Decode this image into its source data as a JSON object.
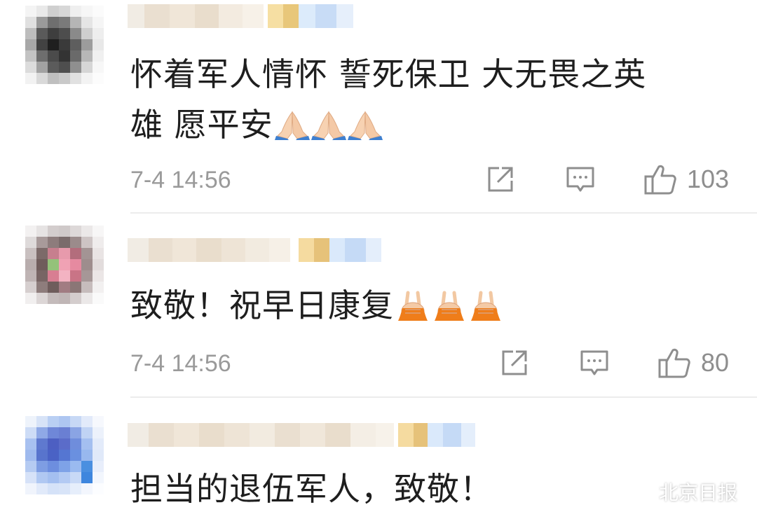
{
  "comments": [
    {
      "content_line1": "怀着军人情怀 誓死保卫  大无畏之英",
      "content_line2": "雄 愿平安",
      "emoji": "folded-hands-emoji",
      "emoji_count": 3,
      "timestamp": "7-4 14:56",
      "likes": "103"
    },
    {
      "content_line1": "致敬！祝早日康复",
      "emoji": "victory-hand-emoji",
      "emoji_count": 3,
      "timestamp": "7-4 14:56",
      "likes": "80"
    },
    {
      "content_line1": "担当的退伍军人，致敬！"
    }
  ],
  "icons": {
    "share": "share-icon",
    "reply": "comment-icon",
    "like": "thumbs-up-icon"
  },
  "watermark": {
    "text": "北京日报",
    "icon": "wechat-icon"
  },
  "colors": {
    "meta_text": "#9a9a9a",
    "content_text": "#1e1e1e",
    "divider": "#ececec"
  }
}
